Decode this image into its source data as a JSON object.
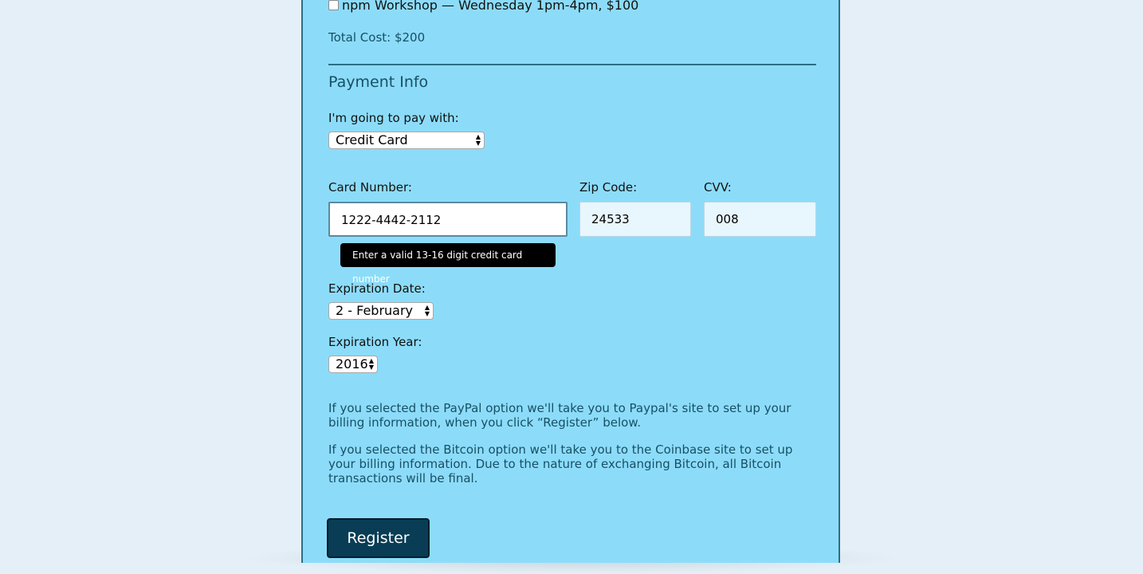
{
  "activity": {
    "label": "npm Workshop — Wednesday 1pm-4pm, $100",
    "checked": false
  },
  "total_cost": "Total Cost: $200",
  "payment": {
    "title": "Payment Info",
    "method_label": "I'm going to pay with:",
    "method_value": "Credit Card",
    "card_number_label": "Card Number:",
    "card_number_value": "1222-4442-2112",
    "zip_label": "Zip Code:",
    "zip_value": "24533",
    "cvv_label": "CVV:",
    "cvv_value": "008",
    "tooltip": "Enter a valid 13-16 digit credit card number",
    "exp_date_label": "Expiration Date:",
    "exp_date_value": "2 - February",
    "exp_year_label": "Expiration Year:",
    "exp_year_value": "2016"
  },
  "info": {
    "paypal": "If you selected the PayPal option we'll take you to Paypal's site to set up your billing information, when you click “Register” below.",
    "bitcoin": "If you selected the Bitcoin option we'll take you to the Coinbase site to set up your billing information. Due to the nature of exchanging Bitcoin, all Bitcoin transactions will be final."
  },
  "register_label": "Register",
  "colors": {
    "page_bg": "#e4eff7",
    "form_bg": "#8cdcf9",
    "accent_text": "#184f66",
    "button_bg": "#083d55"
  }
}
